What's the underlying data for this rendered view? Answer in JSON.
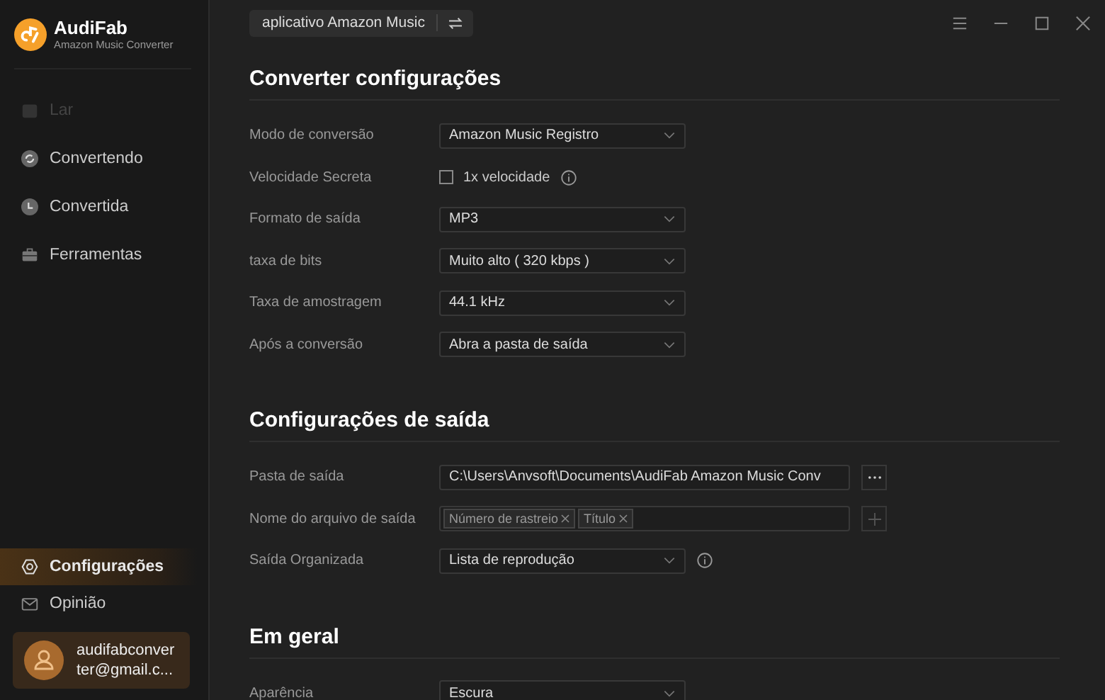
{
  "app": {
    "name": "AudiFab",
    "subtitle": "Amazon Music Converter"
  },
  "sidebar": {
    "items": [
      {
        "kind": "home",
        "label": "Lar",
        "disabled": true,
        "selected": false
      },
      {
        "kind": "converting",
        "label": "Convertendo",
        "disabled": false,
        "selected": false
      },
      {
        "kind": "converted",
        "label": "Convertida",
        "disabled": false,
        "selected": false
      },
      {
        "kind": "tools",
        "label": "Ferramentas",
        "disabled": false,
        "selected": false
      }
    ],
    "bottom_items": [
      {
        "kind": "settings",
        "label": "Configurações",
        "disabled": false,
        "selected": true
      },
      {
        "kind": "feedback",
        "label": "Opinião",
        "disabled": false,
        "selected": false
      }
    ],
    "account": {
      "email": "audifabconverter@gmail.c..."
    }
  },
  "top_bar": {
    "source_button": "aplicativo Amazon Music"
  },
  "sections": [
    {
      "title": "Converter configurações",
      "rows": [
        {
          "kind": "select",
          "label": "Modo de conversão",
          "value": "Amazon Music Registro"
        },
        {
          "kind": "checkbox",
          "label": "Velocidade Secreta",
          "option": "1x velocidade",
          "checked": false,
          "info": true
        },
        {
          "kind": "select",
          "label": "Formato de saída",
          "value": "MP3"
        },
        {
          "kind": "select",
          "label": "taxa de bits",
          "value": "Muito alto ( 320 kbps )"
        },
        {
          "kind": "select",
          "label": "Taxa de amostragem",
          "value": "44.1 kHz"
        },
        {
          "kind": "select",
          "label": "Após a conversão",
          "value": "Abra a pasta de saída"
        }
      ]
    },
    {
      "title": "Configurações de saída",
      "rows": [
        {
          "kind": "path",
          "label": "Pasta de saída",
          "value": "C:\\Users\\Anvsoft\\Documents\\AudiFab Amazon Music Conv"
        },
        {
          "kind": "tags",
          "label": "Nome do arquivo de saída",
          "tags": [
            "Número de rastreio",
            "Título"
          ]
        },
        {
          "kind": "select",
          "label": "Saída Organizada",
          "value": "Lista de reprodução",
          "info": true
        }
      ]
    },
    {
      "title": "Em geral",
      "rows": [
        {
          "kind": "select",
          "label": "Aparência",
          "value": "Escura"
        }
      ]
    }
  ]
}
